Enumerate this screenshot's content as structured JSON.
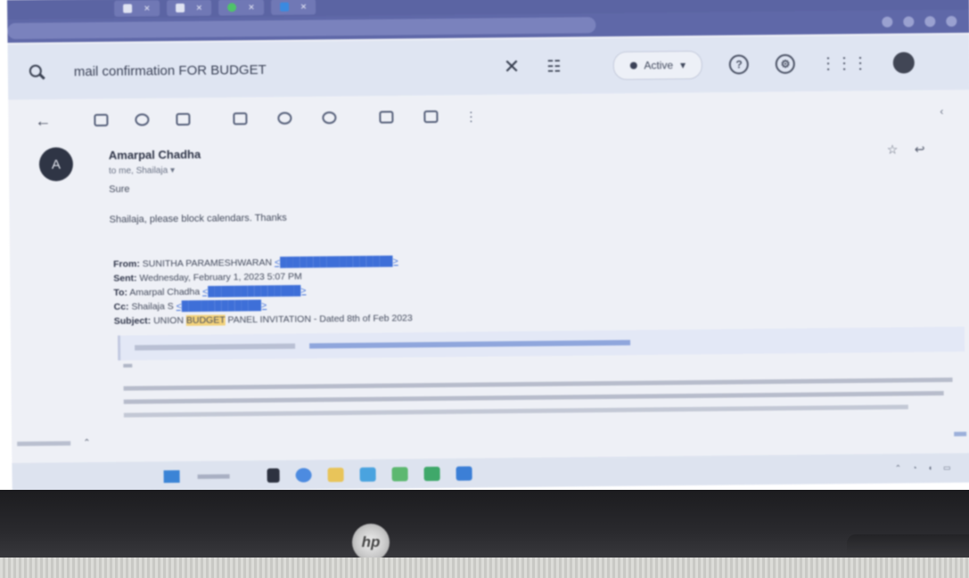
{
  "search": {
    "query": "mail confirmation FOR BUDGET",
    "status_label": "Active"
  },
  "message": {
    "avatar_letter": "A",
    "sender": "Amarpal Chadha",
    "recipients": "to me, Shailaja",
    "body_line1": "Sure",
    "body_line2": "Shailaja, please block calendars. Thanks",
    "forwarded": {
      "from_label": "From:",
      "from_name": "SUNITHA PARAMESHWARAN",
      "sent_label": "Sent:",
      "sent_value": "Wednesday, February 1, 2023 5:07 PM",
      "to_label": "To:",
      "to_name": "Amarpal Chadha",
      "cc_label": "Cc:",
      "cc_name": "Shailaja S",
      "subject_label": "Subject:",
      "subject_pre": "UNION",
      "subject_highlight": "BUDGET",
      "subject_post": "PANEL INVITATION - Dated 8th of Feb 2023"
    }
  },
  "colors": {
    "accent": "#3e6fd8",
    "highlight": "#f3d27a",
    "avatar": "#2f3545"
  }
}
